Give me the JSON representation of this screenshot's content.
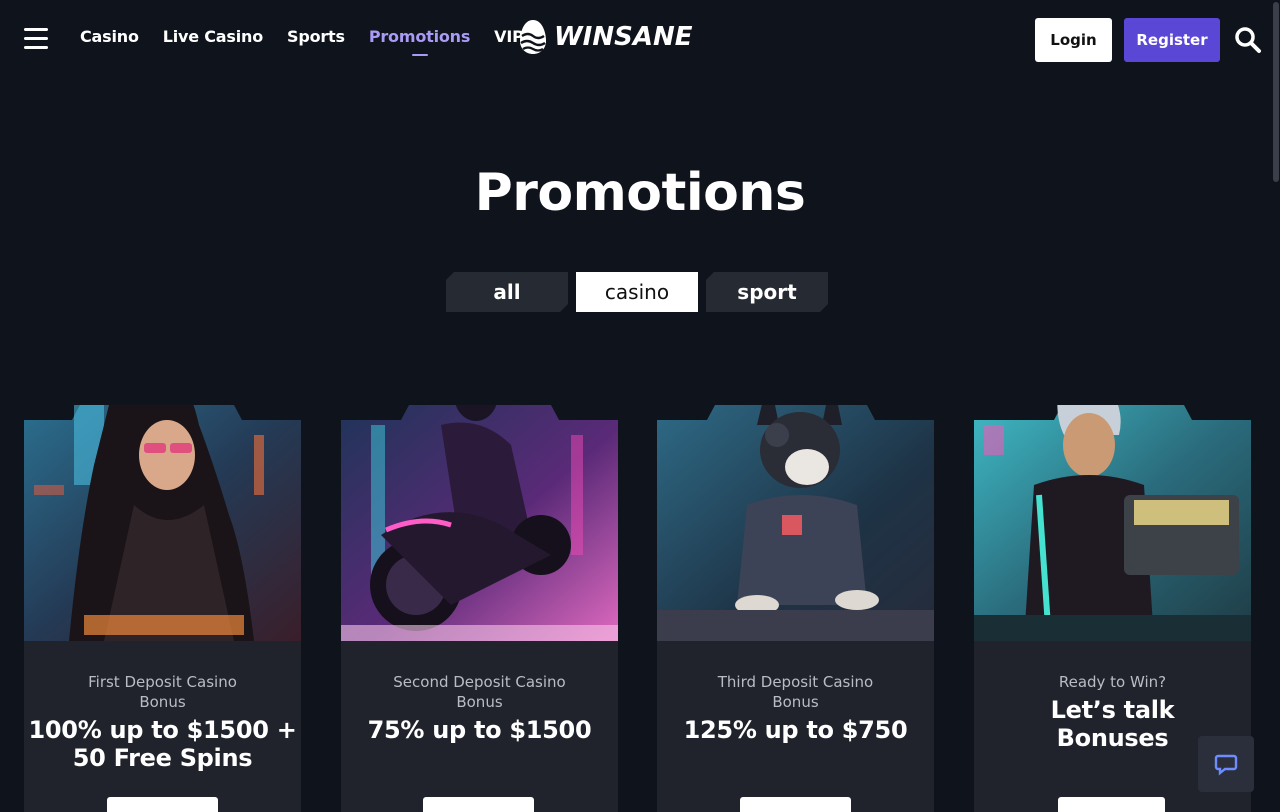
{
  "header": {
    "nav": [
      "Casino",
      "Live Casino",
      "Sports",
      "Promotions",
      "VIP"
    ],
    "active_nav": "Promotions",
    "logo_text": "WINSANE",
    "login_label": "Login",
    "register_label": "Register"
  },
  "page": {
    "title": "Promotions"
  },
  "tabs": [
    "all",
    "casino",
    "sport"
  ],
  "active_tab": "casino",
  "cards": [
    {
      "subtitle": "First Deposit Casino Bonus",
      "headline": "100% up to $1500 + 50 Free Spins",
      "art": "cyberpunk-woman"
    },
    {
      "subtitle": "Second Deposit Casino Bonus",
      "headline": "75% up to $1500",
      "art": "motorcycle-rider"
    },
    {
      "subtitle": "Third Deposit Casino Bonus",
      "headline": "125% up to $750",
      "art": "cyber-dog"
    },
    {
      "subtitle": "Ready to Win?",
      "headline": "Let’s talk Bonuses",
      "art": "woman-with-treasure-chest"
    }
  ],
  "colors": {
    "background": "#0f131b",
    "accent": "#5b47d6",
    "active_nav": "#a99bf5",
    "card": "#20232b"
  },
  "icons": [
    "hamburger-icon",
    "logo-egg-icon",
    "search-icon",
    "chat-icon"
  ]
}
